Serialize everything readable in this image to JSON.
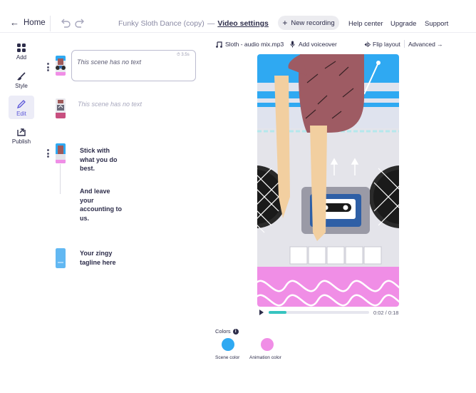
{
  "header": {
    "home_label": "Home",
    "project_title": "Funky Sloth Dance (copy)",
    "separator": "—",
    "video_settings_label": "Video settings",
    "new_recording_label": "New recording",
    "help_center_label": "Help center",
    "upgrade_label": "Upgrade",
    "support_label": "Support"
  },
  "rail": {
    "add": "Add",
    "style": "Style",
    "edit": "Edit",
    "publish": "Publish"
  },
  "scenes": {
    "scene1_text": "This scene has no text",
    "scene1_duration": "⏱ 3.5s",
    "scene2_text": "This scene has no text",
    "scene3_text_a": "Stick with what you do best.",
    "scene3_text_b": "And leave your accounting to us.",
    "scene4_text": "Your zingy tagline here"
  },
  "toolbar": {
    "audio_track": "Sloth - audio mix.mp3",
    "add_voiceover": "Add voiceover",
    "flip_layout": "Flip layout",
    "advanced": "Advanced →"
  },
  "player": {
    "time": "0:02 / 0:18",
    "progress": 0.18
  },
  "colors": {
    "label": "Colors",
    "scene_color_label": "Scene color",
    "animation_color_label": "Animation color",
    "scene_color": "#2fa9f2",
    "animation_color": "#f08ee6"
  },
  "icons": [
    "arrow-left-icon",
    "undo-icon",
    "redo-icon",
    "plus-icon",
    "grid-icon",
    "brush-icon",
    "pencil-icon",
    "publish-icon",
    "music-note-icon",
    "microphone-icon",
    "flip-icon",
    "play-icon",
    "info-icon",
    "timer-icon"
  ]
}
